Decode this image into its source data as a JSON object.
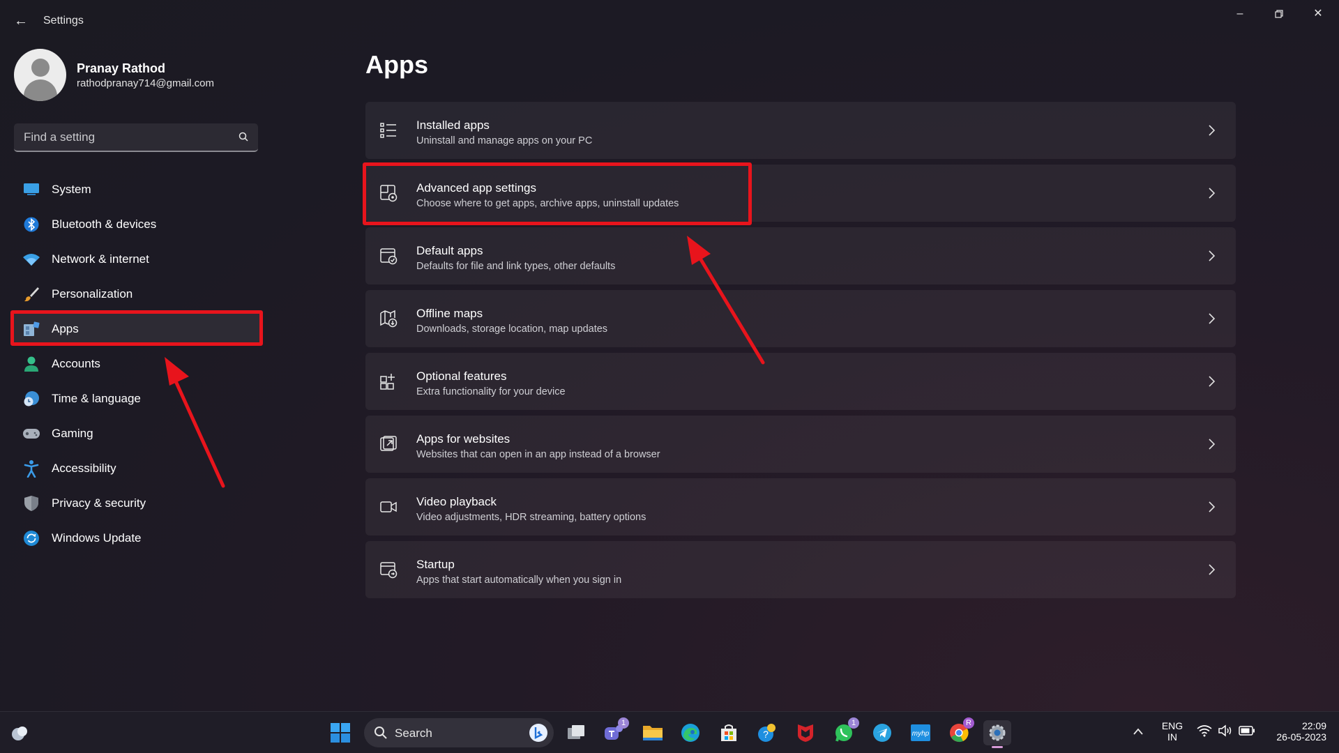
{
  "window": {
    "title": "Settings",
    "back_icon": "arrow-left-icon",
    "controls": [
      "minimize-icon",
      "restore-icon",
      "close-icon"
    ]
  },
  "profile": {
    "name": "Pranay Rathod",
    "email": "rathodpranay714@gmail.com"
  },
  "search": {
    "placeholder": "Find a setting"
  },
  "sidebar": {
    "items": [
      {
        "label": "System",
        "icon": "monitor-icon"
      },
      {
        "label": "Bluetooth & devices",
        "icon": "bluetooth-icon"
      },
      {
        "label": "Network & internet",
        "icon": "wifi-icon"
      },
      {
        "label": "Personalization",
        "icon": "brush-icon"
      },
      {
        "label": "Apps",
        "icon": "apps-icon",
        "selected": true
      },
      {
        "label": "Accounts",
        "icon": "person-icon"
      },
      {
        "label": "Time & language",
        "icon": "clock-globe-icon"
      },
      {
        "label": "Gaming",
        "icon": "gamepad-icon"
      },
      {
        "label": "Accessibility",
        "icon": "accessibility-icon"
      },
      {
        "label": "Privacy & security",
        "icon": "shield-icon"
      },
      {
        "label": "Windows Update",
        "icon": "sync-icon"
      }
    ]
  },
  "main": {
    "title": "Apps",
    "cards": [
      {
        "title": "Installed apps",
        "subtitle": "Uninstall and manage apps on your PC",
        "icon": "list-icon"
      },
      {
        "title": "Advanced app settings",
        "subtitle": "Choose where to get apps, archive apps, uninstall updates",
        "icon": "app-settings-icon"
      },
      {
        "title": "Default apps",
        "subtitle": "Defaults for file and link types, other defaults",
        "icon": "default-apps-icon"
      },
      {
        "title": "Offline maps",
        "subtitle": "Downloads, storage location, map updates",
        "icon": "map-download-icon"
      },
      {
        "title": "Optional features",
        "subtitle": "Extra functionality for your device",
        "icon": "add-grid-icon"
      },
      {
        "title": "Apps for websites",
        "subtitle": "Websites that can open in an app instead of a browser",
        "icon": "open-app-icon"
      },
      {
        "title": "Video playback",
        "subtitle": "Video adjustments, HDR streaming, battery options",
        "icon": "video-camera-icon"
      },
      {
        "title": "Startup",
        "subtitle": "Apps that start automatically when you sign in",
        "icon": "startup-icon"
      }
    ]
  },
  "annotations": {
    "color": "#e8141c"
  },
  "taskbar": {
    "search_label": "Search",
    "apps": [
      "widgets-icon",
      "start-icon",
      "search-icon",
      "bing-icon",
      "task-view-icon",
      "teams-icon",
      "file-explorer-icon",
      "edge-icon",
      "store-icon",
      "tips-icon",
      "mcafee-icon",
      "whatsapp-icon",
      "telegram-icon",
      "myhp-icon",
      "chrome-icon",
      "settings-gear-icon"
    ],
    "badges": {
      "teams": "1",
      "whatsapp": "1",
      "chrome": "R"
    },
    "language": {
      "line1": "ENG",
      "line2": "IN"
    },
    "time": "22:09",
    "date": "26-05-2023"
  },
  "colors": {
    "accent": "#5fa8ff",
    "annotation_red": "#e8141c",
    "card_bg": "#2a2730",
    "background": "#1d1b24"
  }
}
